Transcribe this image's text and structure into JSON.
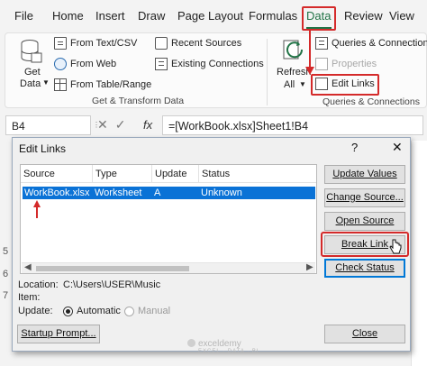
{
  "ribbon_tabs": [
    "File",
    "Home",
    "Insert",
    "Draw",
    "Page Layout",
    "Formulas",
    "Data",
    "Review",
    "View"
  ],
  "active_tab": "Data",
  "ribbon": {
    "get_data": {
      "line1": "Get",
      "line2": "Data"
    },
    "get_transform_items": [
      "From Text/CSV",
      "From Web",
      "From Table/Range"
    ],
    "recent_sources": "Recent Sources",
    "existing_connections": "Existing Connections",
    "get_transform_label": "Get & Transform Data",
    "refresh_all": {
      "line1": "Refresh",
      "line2": "All"
    },
    "queries_connections": "Queries & Connections",
    "properties": "Properties",
    "edit_links": "Edit Links",
    "queries_connections_label": "Queries & Connections"
  },
  "formula_bar": {
    "name_box": "B4",
    "fx": "fx",
    "formula": "=[WorkBook.xlsx]Sheet1!B4"
  },
  "row_numbers": [
    "5",
    "6",
    "7"
  ],
  "dialog": {
    "title": "Edit Links",
    "help": "?",
    "close": "✕",
    "columns": [
      "Source",
      "Type",
      "Update",
      "Status"
    ],
    "rows": [
      {
        "source": "WorkBook.xlsx",
        "type": "Worksheet",
        "update": "A",
        "status": "Unknown"
      }
    ],
    "location_label": "Location:",
    "location_value": "C:\\Users\\USER\\Music",
    "item_label": "Item:",
    "update_label": "Update:",
    "update_options": [
      "Automatic",
      "Manual"
    ],
    "update_selected": "Automatic",
    "buttons": {
      "update_values": "Update Values",
      "change_source": "Change Source...",
      "open_source": "Open Source",
      "break_link": "Break Link",
      "check_status": "Check Status",
      "startup_prompt": "Startup Prompt...",
      "close": "Close"
    }
  },
  "watermark": "exceldemy",
  "watermark_sub": "EXCEL · DATA · BI",
  "colors": {
    "highlight_red": "#d42a2a",
    "selection_blue": "#0a72d6",
    "excel_green": "#217346"
  }
}
